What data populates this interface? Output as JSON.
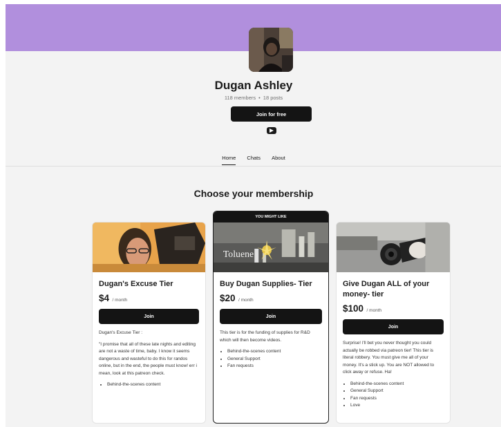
{
  "creator": {
    "name": "Dugan Ashley",
    "members": "118 members",
    "separator": "•",
    "posts": "18 posts",
    "join_label": "Join for free",
    "social_icon": "youtube-icon"
  },
  "tabs": [
    {
      "label": "Home",
      "active": true
    },
    {
      "label": "Chats",
      "active": false
    },
    {
      "label": "About",
      "active": false
    }
  ],
  "section_title": "Choose your membership",
  "tiers": [
    {
      "name": "Dugan's Excuse Tier",
      "price": "$4",
      "period": "/ month",
      "join_label": "Join",
      "description": [
        "Dugan's Excuse Tier :",
        "\"I promise that all of these late nights and editing are not a waste of time, baby. I know it seems dangerous and wasteful to do this for randos online, but in the end, the people must know! err i mean, look at this patreon check."
      ],
      "benefits": [
        "Behind-the-scenes content"
      ]
    },
    {
      "ribbon": "YOU MIGHT LIKE",
      "name": "Buy Dugan Supplies- Tier",
      "price": "$20",
      "period": "/ month",
      "join_label": "Join",
      "image_text": "Toluene",
      "description": [
        "This tier is for the funding of supplies for R&D which will then become videos."
      ],
      "benefits": [
        "Behind-the-scenes content",
        "General Support",
        "Fan requests"
      ]
    },
    {
      "name": "Give Dugan ALL of your money- tier",
      "price": "$100",
      "period": "/ month",
      "join_label": "Join",
      "description": [
        "Surprise! I'll bet you never thought you could actually be robbed via patreon tier! This tier is literal robbery. You must give me all of your money. It's a stick up. You are NOT allowed to click away or refuse. Ha!"
      ],
      "benefits": [
        "Behind-the-scenes content",
        "General Support",
        "Fan requests",
        "Love"
      ]
    }
  ],
  "colors": {
    "banner": "#b18fdd",
    "page_background": "#f3f3f3",
    "button": "#141414"
  }
}
